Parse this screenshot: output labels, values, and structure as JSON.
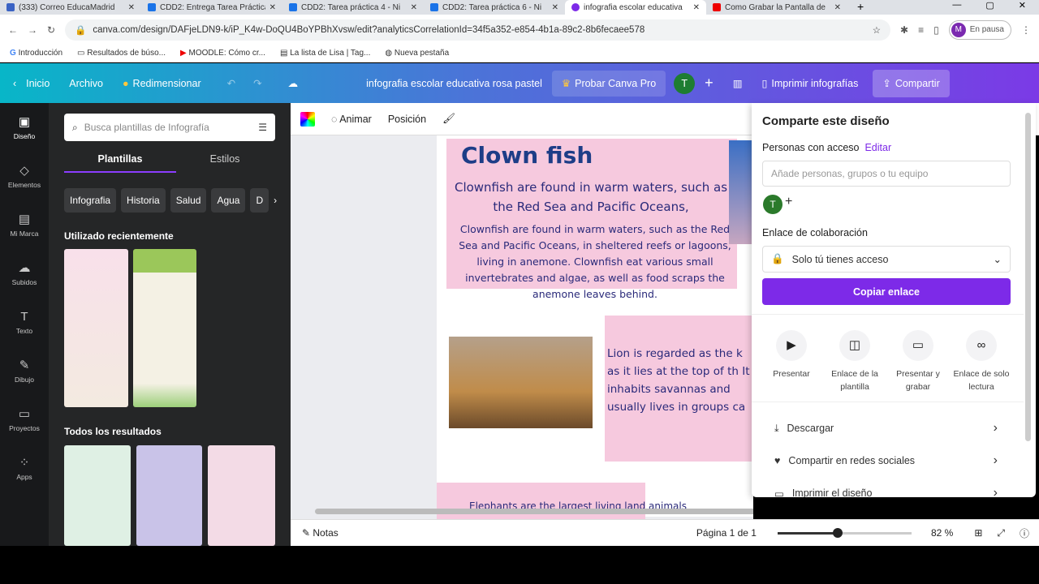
{
  "browser": {
    "tabs": [
      {
        "title": "(333) Correo EducaMadrid",
        "color": "#3b63c4"
      },
      {
        "title": "CDD2: Entrega Tarea Práctica",
        "color": "#1a73e8"
      },
      {
        "title": "CDD2: Tarea práctica 4 - Ni",
        "color": "#1a73e8"
      },
      {
        "title": "CDD2: Tarea práctica 6 - Ni",
        "color": "#1a73e8"
      },
      {
        "title": "infografia escolar educativa",
        "color": "#7d2ae8"
      },
      {
        "title": "Como Grabar la Pantalla de",
        "color": "#e00"
      }
    ],
    "url": "canva.com/design/DAFjeLDN9-k/iP_K4w-DoQU4BoYPBhXvsw/edit?analyticsCorrelationId=34f5a352-e854-4b1a-89c2-8b6fecaee578",
    "profile_status": "En pausa",
    "profile_initial": "M",
    "bookmarks": [
      "Introducción",
      "Resultados de búso...",
      "MOODLE: Cómo cr...",
      "La lista de Lisa | Tag...",
      "Nueva pestaña"
    ]
  },
  "header": {
    "home": "Inicio",
    "file": "Archivo",
    "resize": "Redimensionar",
    "title": "infografia escolar educativa rosa pastel",
    "pro": "Probar Canva Pro",
    "avatar": "T",
    "print": "Imprimir infografías",
    "share": "Compartir"
  },
  "rail": [
    "Diseño",
    "Elementos",
    "Mi Marca",
    "Subidos",
    "Texto",
    "Dibujo",
    "Proyectos",
    "Apps"
  ],
  "panel": {
    "search_placeholder": "Busca plantillas de Infografía",
    "tabs": [
      "Plantillas",
      "Estilos"
    ],
    "chips": [
      "Infografia",
      "Historia",
      "Salud",
      "Agua",
      "D"
    ],
    "recent": "Utilizado recientemente",
    "all": "Todos los resultados"
  },
  "toolbar": {
    "animate": "Animar",
    "position": "Posición"
  },
  "design": {
    "title": "Clown fish",
    "sub": "Clownfish are found in warm waters, such as the Red Sea and Pacific Oceans,",
    "body": "Clownfish are found in warm waters, such as the Red Sea and Pacific Oceans, in sheltered reefs or lagoons, living in anemone. Clownfish eat various small invertebrates and algae, as well as food scraps the anemone leaves behind.",
    "lion": "Lion is regarded as the k as it lies at the top of th It inhabits savannas and usually lives in groups ca",
    "elephant": "Elephants are the largest living land animals"
  },
  "share": {
    "title": "Comparte este diseño",
    "people": "Personas con acceso",
    "edit": "Editar",
    "placeholder": "Añade personas, grupos o tu equipo",
    "avatar": "T",
    "collab": "Enlace de colaboración",
    "access": "Solo tú tienes acceso",
    "copy": "Copiar enlace",
    "actions": [
      "Presentar",
      "Enlace de la plantilla",
      "Presentar y grabar",
      "Enlace de solo lectura"
    ],
    "rows": [
      "Descargar",
      "Compartir en redes sociales",
      "Imprimir el diseño"
    ]
  },
  "bottom": {
    "notes": "Notas",
    "page": "Página 1 de 1",
    "zoom": "82 %",
    "zoom_fraction": 0.82
  }
}
